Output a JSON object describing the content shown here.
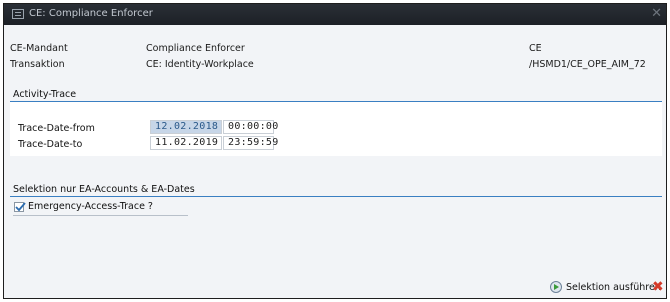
{
  "window": {
    "title": "CE: Compliance Enforcer",
    "close_glyph": "✕"
  },
  "header": {
    "rows": [
      {
        "label": "CE-Mandant",
        "value": "Compliance Enforcer",
        "extra": "CE"
      },
      {
        "label": "Transaktion",
        "value": "CE: Identity-Workplace",
        "extra": "/HSMD1/CE_OPE_AIM_72"
      }
    ]
  },
  "activity_trace": {
    "group_title": "Activity-Trace",
    "from": {
      "label": "Trace-Date-from",
      "date": "12.02.2018",
      "time": "00:00:00"
    },
    "to": {
      "label": "Trace-Date-to",
      "date": "11.02.2019",
      "time": "23:59:59"
    }
  },
  "selektion": {
    "group_title": "Selektion nur EA-Accounts & EA-Dates",
    "checkbox_label": "Emergency-Access-Trace ?",
    "checked": true
  },
  "footer": {
    "run_label": "Selektion ausführen",
    "cancel_glyph": "✖",
    "run_icon": "execute-icon",
    "cancel_icon": "cancel-icon"
  },
  "colors": {
    "accent_line": "#3a7fc2",
    "selection": "#c7d6e8",
    "cancel": "#d43a2a"
  }
}
